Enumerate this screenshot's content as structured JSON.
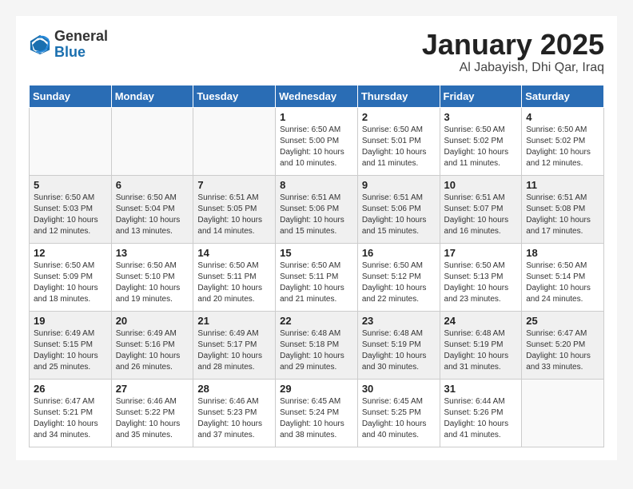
{
  "header": {
    "logo_general": "General",
    "logo_blue": "Blue",
    "title": "January 2025",
    "subtitle": "Al Jabayish, Dhi Qar, Iraq"
  },
  "weekdays": [
    "Sunday",
    "Monday",
    "Tuesday",
    "Wednesday",
    "Thursday",
    "Friday",
    "Saturday"
  ],
  "weeks": [
    [
      {
        "day": "",
        "info": ""
      },
      {
        "day": "",
        "info": ""
      },
      {
        "day": "",
        "info": ""
      },
      {
        "day": "1",
        "info": "Sunrise: 6:50 AM\nSunset: 5:00 PM\nDaylight: 10 hours\nand 10 minutes."
      },
      {
        "day": "2",
        "info": "Sunrise: 6:50 AM\nSunset: 5:01 PM\nDaylight: 10 hours\nand 11 minutes."
      },
      {
        "day": "3",
        "info": "Sunrise: 6:50 AM\nSunset: 5:02 PM\nDaylight: 10 hours\nand 11 minutes."
      },
      {
        "day": "4",
        "info": "Sunrise: 6:50 AM\nSunset: 5:02 PM\nDaylight: 10 hours\nand 12 minutes."
      }
    ],
    [
      {
        "day": "5",
        "info": "Sunrise: 6:50 AM\nSunset: 5:03 PM\nDaylight: 10 hours\nand 12 minutes."
      },
      {
        "day": "6",
        "info": "Sunrise: 6:50 AM\nSunset: 5:04 PM\nDaylight: 10 hours\nand 13 minutes."
      },
      {
        "day": "7",
        "info": "Sunrise: 6:51 AM\nSunset: 5:05 PM\nDaylight: 10 hours\nand 14 minutes."
      },
      {
        "day": "8",
        "info": "Sunrise: 6:51 AM\nSunset: 5:06 PM\nDaylight: 10 hours\nand 15 minutes."
      },
      {
        "day": "9",
        "info": "Sunrise: 6:51 AM\nSunset: 5:06 PM\nDaylight: 10 hours\nand 15 minutes."
      },
      {
        "day": "10",
        "info": "Sunrise: 6:51 AM\nSunset: 5:07 PM\nDaylight: 10 hours\nand 16 minutes."
      },
      {
        "day": "11",
        "info": "Sunrise: 6:51 AM\nSunset: 5:08 PM\nDaylight: 10 hours\nand 17 minutes."
      }
    ],
    [
      {
        "day": "12",
        "info": "Sunrise: 6:50 AM\nSunset: 5:09 PM\nDaylight: 10 hours\nand 18 minutes."
      },
      {
        "day": "13",
        "info": "Sunrise: 6:50 AM\nSunset: 5:10 PM\nDaylight: 10 hours\nand 19 minutes."
      },
      {
        "day": "14",
        "info": "Sunrise: 6:50 AM\nSunset: 5:11 PM\nDaylight: 10 hours\nand 20 minutes."
      },
      {
        "day": "15",
        "info": "Sunrise: 6:50 AM\nSunset: 5:11 PM\nDaylight: 10 hours\nand 21 minutes."
      },
      {
        "day": "16",
        "info": "Sunrise: 6:50 AM\nSunset: 5:12 PM\nDaylight: 10 hours\nand 22 minutes."
      },
      {
        "day": "17",
        "info": "Sunrise: 6:50 AM\nSunset: 5:13 PM\nDaylight: 10 hours\nand 23 minutes."
      },
      {
        "day": "18",
        "info": "Sunrise: 6:50 AM\nSunset: 5:14 PM\nDaylight: 10 hours\nand 24 minutes."
      }
    ],
    [
      {
        "day": "19",
        "info": "Sunrise: 6:49 AM\nSunset: 5:15 PM\nDaylight: 10 hours\nand 25 minutes."
      },
      {
        "day": "20",
        "info": "Sunrise: 6:49 AM\nSunset: 5:16 PM\nDaylight: 10 hours\nand 26 minutes."
      },
      {
        "day": "21",
        "info": "Sunrise: 6:49 AM\nSunset: 5:17 PM\nDaylight: 10 hours\nand 28 minutes."
      },
      {
        "day": "22",
        "info": "Sunrise: 6:48 AM\nSunset: 5:18 PM\nDaylight: 10 hours\nand 29 minutes."
      },
      {
        "day": "23",
        "info": "Sunrise: 6:48 AM\nSunset: 5:19 PM\nDaylight: 10 hours\nand 30 minutes."
      },
      {
        "day": "24",
        "info": "Sunrise: 6:48 AM\nSunset: 5:19 PM\nDaylight: 10 hours\nand 31 minutes."
      },
      {
        "day": "25",
        "info": "Sunrise: 6:47 AM\nSunset: 5:20 PM\nDaylight: 10 hours\nand 33 minutes."
      }
    ],
    [
      {
        "day": "26",
        "info": "Sunrise: 6:47 AM\nSunset: 5:21 PM\nDaylight: 10 hours\nand 34 minutes."
      },
      {
        "day": "27",
        "info": "Sunrise: 6:46 AM\nSunset: 5:22 PM\nDaylight: 10 hours\nand 35 minutes."
      },
      {
        "day": "28",
        "info": "Sunrise: 6:46 AM\nSunset: 5:23 PM\nDaylight: 10 hours\nand 37 minutes."
      },
      {
        "day": "29",
        "info": "Sunrise: 6:45 AM\nSunset: 5:24 PM\nDaylight: 10 hours\nand 38 minutes."
      },
      {
        "day": "30",
        "info": "Sunrise: 6:45 AM\nSunset: 5:25 PM\nDaylight: 10 hours\nand 40 minutes."
      },
      {
        "day": "31",
        "info": "Sunrise: 6:44 AM\nSunset: 5:26 PM\nDaylight: 10 hours\nand 41 minutes."
      },
      {
        "day": "",
        "info": ""
      }
    ]
  ]
}
